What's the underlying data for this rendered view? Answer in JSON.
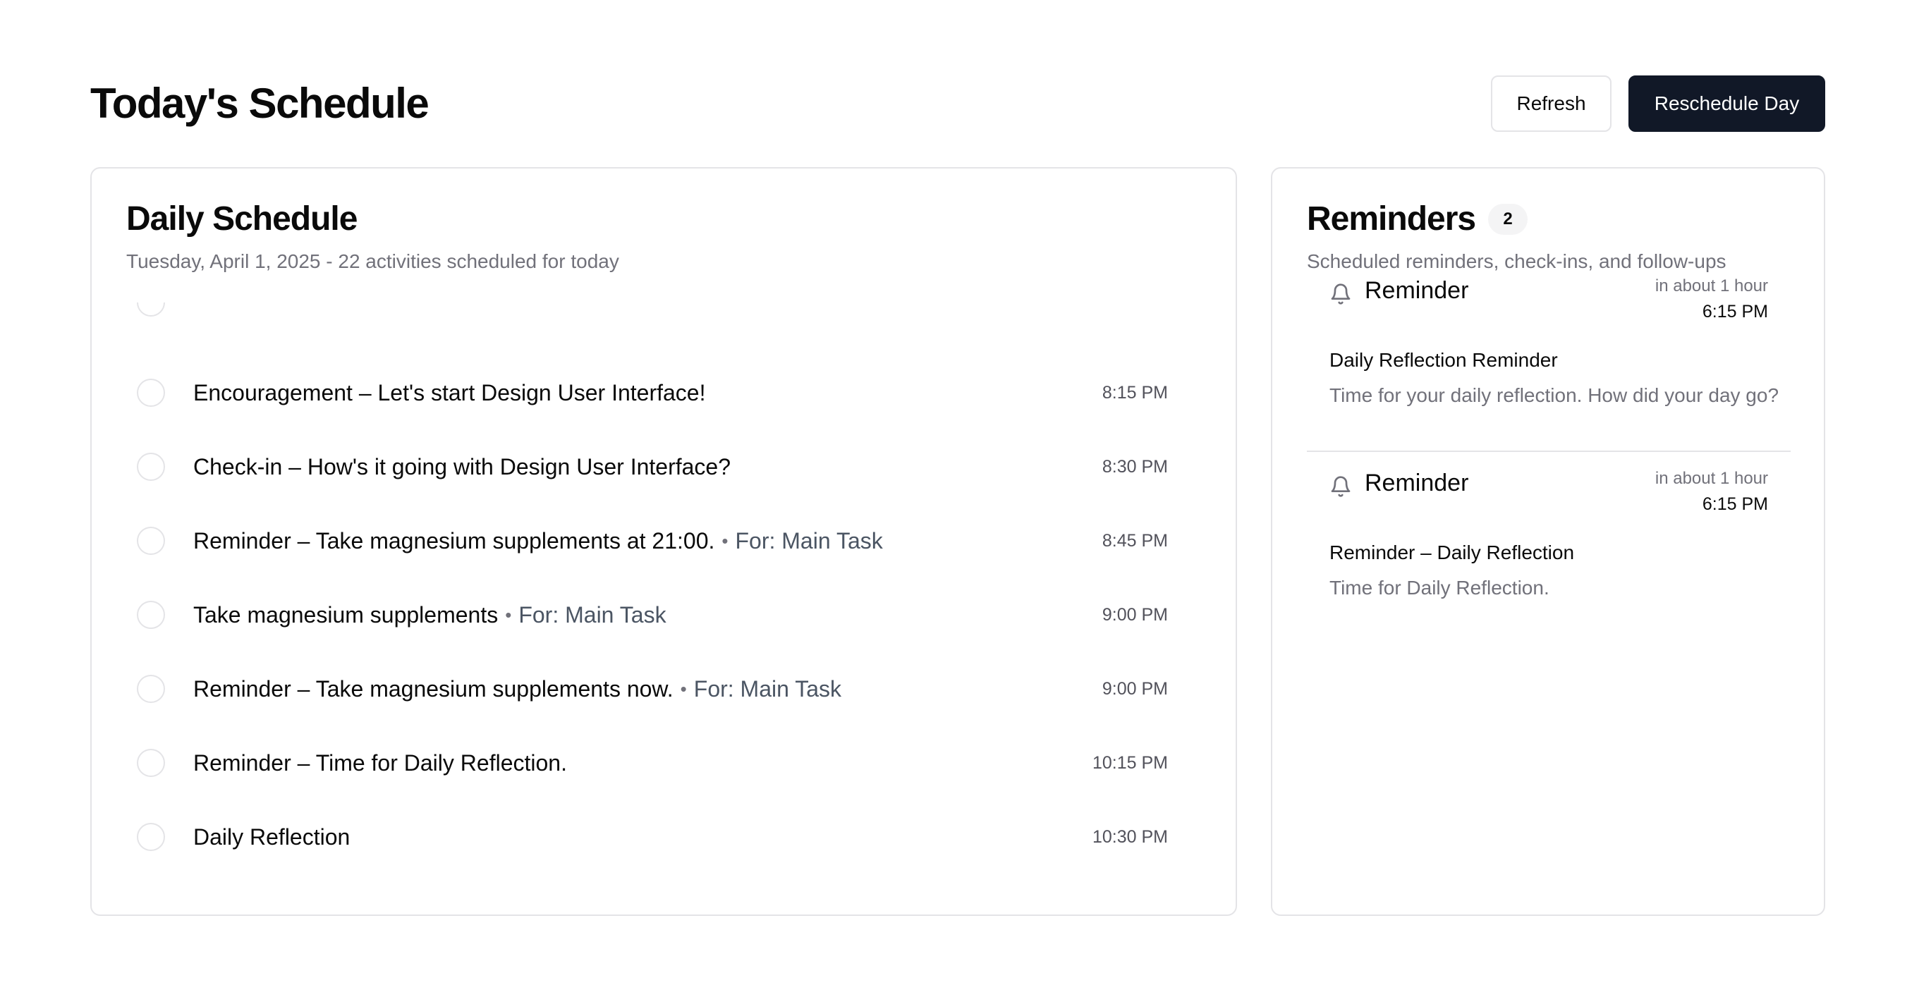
{
  "header": {
    "title": "Today's Schedule",
    "refresh_label": "Refresh",
    "reschedule_label": "Reschedule Day"
  },
  "schedule": {
    "title": "Daily Schedule",
    "subtitle": "Tuesday, April 1, 2025 - 22 activities scheduled for today",
    "items": [
      {
        "title": "Encouragement – Let's start Design User Interface!",
        "for": "",
        "time": "8:15 PM",
        "completed": false
      },
      {
        "title": "Check-in – How's it going with Design User Interface?",
        "for": "",
        "time": "8:30 PM",
        "completed": false
      },
      {
        "title": "Reminder – Take magnesium supplements at 21:00.",
        "for": "For: Main Task",
        "time": "8:45 PM",
        "completed": false
      },
      {
        "title": "Take magnesium supplements",
        "for": "For: Main Task",
        "time": "9:00 PM",
        "completed": false
      },
      {
        "title": "Reminder – Take magnesium supplements now.",
        "for": "For: Main Task",
        "time": "9:00 PM",
        "completed": false
      },
      {
        "title": "Reminder – Time for Daily Reflection.",
        "for": "",
        "time": "10:15 PM",
        "completed": false
      },
      {
        "title": "Daily Reflection",
        "for": "",
        "time": "10:30 PM",
        "completed": false
      }
    ]
  },
  "reminders": {
    "title": "Reminders",
    "count": "2",
    "subtitle": "Scheduled reminders, check-ins, and follow-ups",
    "items": [
      {
        "type": "Reminder",
        "icon": "bell-icon",
        "relative": "in about 1 hour",
        "time": "6:15 PM",
        "title": "Daily Reflection Reminder",
        "description": "Time for your daily reflection. How did your day go?"
      },
      {
        "type": "Reminder",
        "icon": "bell-icon",
        "relative": "in about 1 hour",
        "time": "6:15 PM",
        "title": "Reminder – Daily Reflection",
        "description": "Time for Daily Reflection."
      }
    ]
  },
  "colors": {
    "primary_button": "#111827",
    "border": "#e4e4e7",
    "muted_text": "#71717a"
  }
}
